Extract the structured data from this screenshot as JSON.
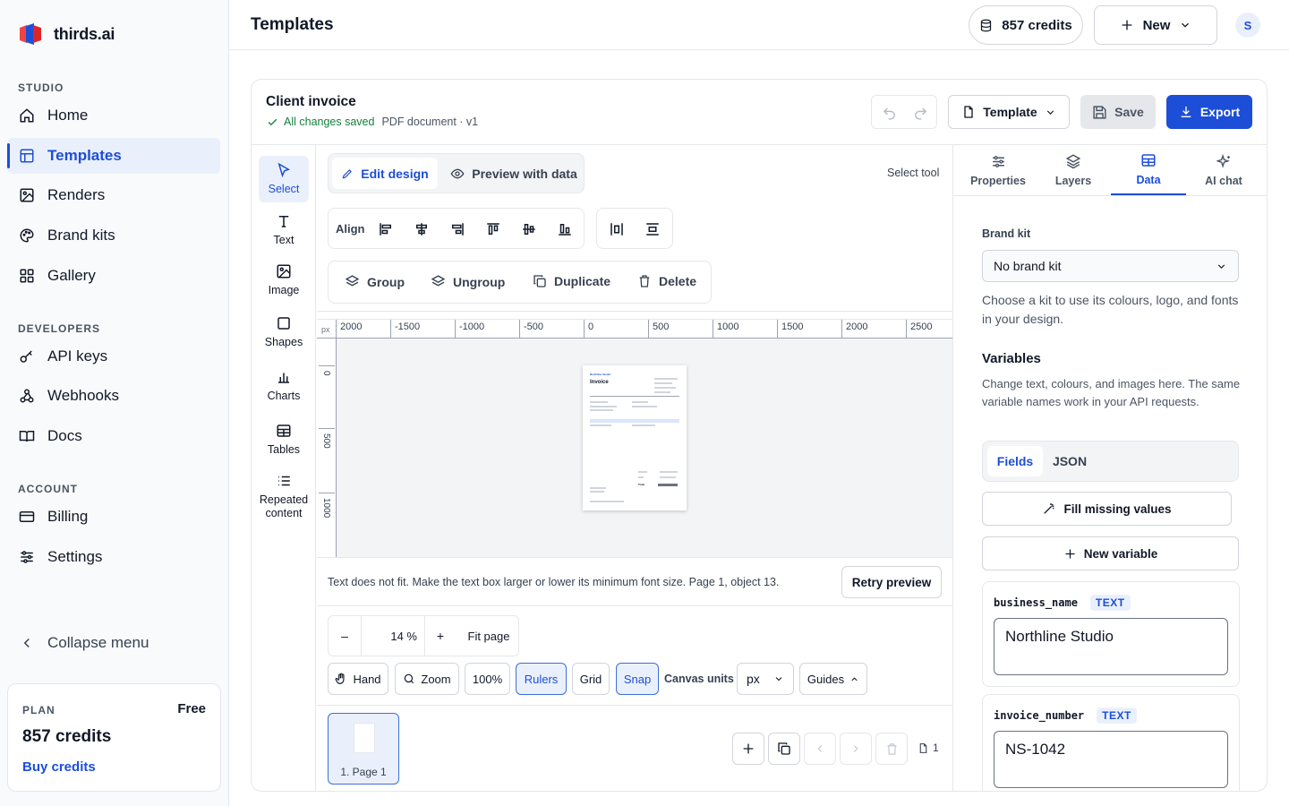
{
  "app": {
    "name": "thirds.ai"
  },
  "sidebar": {
    "sections": {
      "studio": "STUDIO",
      "developers": "DEVELOPERS",
      "account": "ACCOUNT"
    },
    "items": {
      "home": "Home",
      "templates": "Templates",
      "renders": "Renders",
      "brand_kits": "Brand kits",
      "gallery": "Gallery",
      "api_keys": "API keys",
      "webhooks": "Webhooks",
      "docs": "Docs",
      "billing": "Billing",
      "settings": "Settings"
    },
    "collapse": "Collapse menu",
    "plan": {
      "label": "PLAN",
      "tier": "Free",
      "credits": "857 credits",
      "buy": "Buy credits"
    }
  },
  "header": {
    "title": "Templates",
    "credits": "857 credits",
    "new_label": "New",
    "avatar": "S"
  },
  "editor": {
    "doc_title": "Client invoice",
    "save_status": "All changes saved",
    "doc_meta": "PDF document · v1",
    "template_label": "Template",
    "save_label": "Save",
    "export_label": "Export",
    "tools": {
      "select": "Select",
      "text": "Text",
      "image": "Image",
      "shapes": "Shapes",
      "charts": "Charts",
      "tables": "Tables",
      "repeated": "Repeated content"
    },
    "modes": {
      "edit": "Edit design",
      "preview": "Preview with data"
    },
    "current_tool": "Select tool",
    "align_label": "Align",
    "actions": {
      "group": "Group",
      "ungroup": "Ungroup",
      "duplicate": "Duplicate",
      "delete": "Delete"
    },
    "ruler": {
      "unit": "px",
      "h_ticks": [
        "2000",
        "-1500",
        "-1000",
        "-500",
        "0",
        "500",
        "1000",
        "1500",
        "2000",
        "2500"
      ],
      "v_ticks": [
        "0",
        "500",
        "1000"
      ]
    },
    "thumbnail": {
      "brand": "Northline Studio",
      "heading": "Invoice",
      "total": "Total"
    },
    "warning": "Text does not fit. Make the text box larger or lower its minimum font size. Page 1, object 13.",
    "retry": "Retry preview",
    "zoom": {
      "minus": "–",
      "value": "14 %",
      "plus": "+",
      "fit": "Fit page"
    },
    "view": {
      "hand": "Hand",
      "zoom": "Zoom",
      "hundred": "100%",
      "rulers": "Rulers",
      "grid": "Grid",
      "snap": "Snap",
      "canvas_units": "Canvas units",
      "units_value": "px",
      "guides": "Guides"
    },
    "page": {
      "label": "1. Page 1",
      "count": "1"
    }
  },
  "panel": {
    "tabs": {
      "properties": "Properties",
      "layers": "Layers",
      "data": "Data",
      "ai_chat": "AI chat"
    },
    "brand_kit_label": "Brand kit",
    "brand_kit_value": "No brand kit",
    "brand_kit_help": "Choose a kit to use its colours, logo, and fonts in your design.",
    "variables_title": "Variables",
    "variables_help": "Change text, colours, and images here. The same variable names work in your API requests.",
    "subtabs": {
      "fields": "Fields",
      "json": "JSON"
    },
    "fill_missing": "Fill missing values",
    "new_variable": "New variable",
    "vars": [
      {
        "name": "business_name",
        "type": "TEXT",
        "value": "Northline Studio"
      },
      {
        "name": "invoice_number",
        "type": "TEXT",
        "value": "NS-1042"
      }
    ]
  },
  "colors": {
    "accent": "#1d4ed8",
    "accent_light": "#eaf0fb",
    "success": "#15803d"
  }
}
